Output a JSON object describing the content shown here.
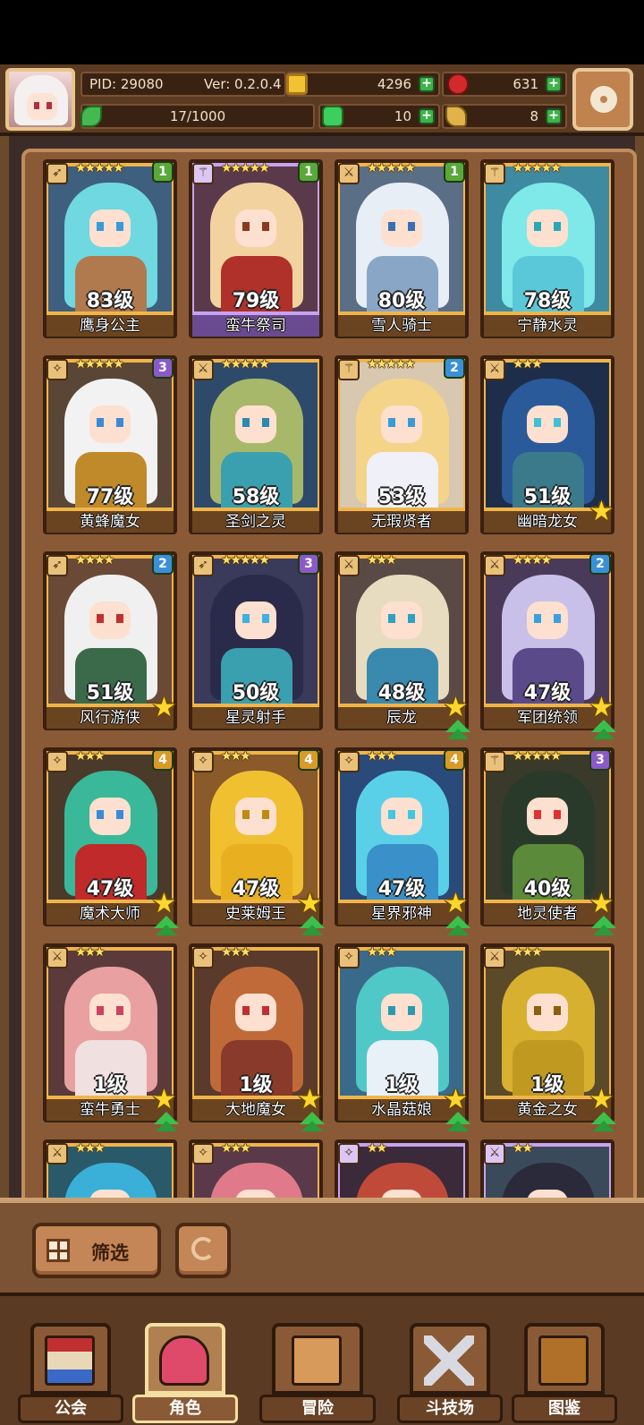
{
  "header": {
    "pid": "PID: 29080",
    "version": "Ver: 0.2.0.4",
    "gold": "4296",
    "gems": "631",
    "exp": "17/1000",
    "clover": "10",
    "keys": "8"
  },
  "heroes": [
    {
      "name": "鹰身公主",
      "level": "83级",
      "stars": "★★★★★",
      "rank": "1",
      "rank_color": "#5aa83a",
      "class_icon": "bow",
      "frame": "gold",
      "colors": {
        "bg": "#3e5f7e",
        "hair": "#6fd8e0",
        "body": "#b07a4e",
        "eye": "#3a9ad8"
      }
    },
    {
      "name": "蛮牛祭司",
      "level": "79级",
      "stars": "★★★★★",
      "rank": "1",
      "rank_color": "#5aa83a",
      "class_icon": "staff",
      "frame": "purple",
      "colors": {
        "bg": "#5a3a4a",
        "hair": "#f2d3a0",
        "body": "#b0302a",
        "eye": "#8a3a20"
      }
    },
    {
      "name": "雪人骑士",
      "level": "80级",
      "stars": "★★★★★",
      "rank": "1",
      "rank_color": "#5aa83a",
      "class_icon": "sword",
      "frame": "gold",
      "colors": {
        "bg": "#5a6e86",
        "hair": "#e8eef6",
        "body": "#8aa6c6",
        "eye": "#3a70b0"
      }
    },
    {
      "name": "宁静水灵",
      "level": "78级",
      "stars": "★★★★★",
      "rank": "",
      "rank_color": "",
      "class_icon": "staff",
      "frame": "gold",
      "colors": {
        "bg": "#3e8aa0",
        "hair": "#7fe8e8",
        "body": "#5ac8d8",
        "eye": "#2aa8b8"
      }
    },
    {
      "name": "黄蜂魔女",
      "level": "77级",
      "stars": "★★★★★",
      "rank": "3",
      "rank_color": "#8a5ac8",
      "class_icon": "wand",
      "frame": "gold",
      "colors": {
        "bg": "#5a4636",
        "hair": "#f2f2f2",
        "body": "#c08a2a",
        "eye": "#3a8ad8"
      }
    },
    {
      "name": "圣剑之灵",
      "level": "58级",
      "stars": "★★★★★",
      "rank": "",
      "rank_color": "",
      "class_icon": "sword",
      "frame": "gold",
      "colors": {
        "bg": "#2e4a6a",
        "hair": "#a8b86a",
        "body": "#3aa0b0",
        "eye": "#2a8ab0"
      }
    },
    {
      "name": "无瑕贤者",
      "level": "53级",
      "stars": "★★★★★",
      "rank": "2",
      "rank_color": "#3a90d8",
      "class_icon": "staff",
      "frame": "gold",
      "colors": {
        "bg": "#d8c8b0",
        "hair": "#f4d488",
        "body": "#f0f0f8",
        "eye": "#3a9ad8"
      }
    },
    {
      "name": "幽暗龙女",
      "level": "51级",
      "stars": "★★★",
      "rank": "",
      "rank_color": "",
      "class_icon": "sword",
      "frame": "gold",
      "star_badge": true,
      "colors": {
        "bg": "#1e2e4a",
        "hair": "#2a5a9a",
        "body": "#3a7a8a",
        "eye": "#40c0d8"
      }
    },
    {
      "name": "风行游侠",
      "level": "51级",
      "stars": "★★★★",
      "rank": "2",
      "rank_color": "#3a90d8",
      "class_icon": "bow",
      "frame": "gold",
      "star_badge": true,
      "colors": {
        "bg": "#6a4a36",
        "hair": "#f0f0f0",
        "body": "#3a6a4a",
        "eye": "#c03030"
      }
    },
    {
      "name": "星灵射手",
      "level": "50级",
      "stars": "★★★★★",
      "rank": "3",
      "rank_color": "#8a5ac8",
      "class_icon": "bow",
      "frame": "gold",
      "colors": {
        "bg": "#3a3a5a",
        "hair": "#2a2a4a",
        "body": "#3aa0b0",
        "eye": "#40b0e0"
      }
    },
    {
      "name": "辰龙",
      "level": "48级",
      "stars": "★★★",
      "rank": "",
      "rank_color": "",
      "class_icon": "sword",
      "frame": "gold",
      "star_badge": true,
      "up_badge": true,
      "colors": {
        "bg": "#5a4a46",
        "hair": "#e8dcc0",
        "body": "#3a8ab0",
        "eye": "#30a0c0"
      }
    },
    {
      "name": "军团统领",
      "level": "47级",
      "stars": "★★★★",
      "rank": "2",
      "rank_color": "#3a90d8",
      "class_icon": "sword",
      "frame": "gold",
      "star_badge": true,
      "up_badge": true,
      "colors": {
        "bg": "#4a3a5a",
        "hair": "#c8c0e8",
        "body": "#5a4a8a",
        "eye": "#3aa0e0"
      }
    },
    {
      "name": "魔术大师",
      "level": "47级",
      "stars": "★★★",
      "rank": "4",
      "rank_color": "#d89a2a",
      "class_icon": "wand",
      "frame": "gold",
      "star_badge": true,
      "up_badge": true,
      "colors": {
        "bg": "#4a3a2a",
        "hair": "#3ab89a",
        "body": "#c02a2a",
        "eye": "#3a8ad8"
      }
    },
    {
      "name": "史莱姆王",
      "level": "47级",
      "stars": "★★★",
      "rank": "4",
      "rank_color": "#d89a2a",
      "class_icon": "wand",
      "frame": "gold",
      "star_badge": true,
      "up_badge": true,
      "colors": {
        "bg": "#8a5a2a",
        "hair": "#f0c030",
        "body": "#e8b020",
        "eye": "#c08a10"
      }
    },
    {
      "name": "星界邪神",
      "level": "47级",
      "stars": "★★★",
      "rank": "4",
      "rank_color": "#d89a2a",
      "class_icon": "wand",
      "frame": "gold",
      "star_badge": true,
      "up_badge": true,
      "colors": {
        "bg": "#2a4a7a",
        "hair": "#5ad0e8",
        "body": "#3a90c8",
        "eye": "#40c8e0"
      }
    },
    {
      "name": "地灵使者",
      "level": "40级",
      "stars": "★★★★★",
      "rank": "3",
      "rank_color": "#8a5ac8",
      "class_icon": "staff",
      "frame": "gold",
      "star_badge": true,
      "up_badge": true,
      "colors": {
        "bg": "#3a3a2a",
        "hair": "#2a3a2a",
        "body": "#5a8a3a",
        "eye": "#e03030"
      }
    },
    {
      "name": "蛮牛勇士",
      "level": "1级",
      "stars": "★★★",
      "rank": "",
      "rank_color": "",
      "class_icon": "sword",
      "frame": "gold",
      "star_badge": true,
      "up_badge": true,
      "colors": {
        "bg": "#5a3a3a",
        "hair": "#e8a0a0",
        "body": "#f0e0e0",
        "eye": "#d04060"
      }
    },
    {
      "name": "大地魔女",
      "level": "1级",
      "stars": "★★★",
      "rank": "",
      "rank_color": "",
      "class_icon": "wand",
      "frame": "gold",
      "star_badge": true,
      "up_badge": true,
      "colors": {
        "bg": "#5a3a2a",
        "hair": "#c06a3a",
        "body": "#8a3a2a",
        "eye": "#c03030"
      }
    },
    {
      "name": "水晶菇娘",
      "level": "1级",
      "stars": "★★★",
      "rank": "",
      "rank_color": "",
      "class_icon": "wand",
      "frame": "gold",
      "star_badge": true,
      "up_badge": true,
      "colors": {
        "bg": "#3a6a8a",
        "hair": "#50c8c8",
        "body": "#e8f0f8",
        "eye": "#2a9ab0"
      }
    },
    {
      "name": "黄金之女",
      "level": "1级",
      "stars": "★★★",
      "rank": "",
      "rank_color": "",
      "class_icon": "sword",
      "frame": "gold",
      "star_badge": true,
      "up_badge": true,
      "colors": {
        "bg": "#5a4a2a",
        "hair": "#d8b030",
        "body": "#c09a20",
        "eye": "#8a6010"
      }
    },
    {
      "name": "",
      "level": "",
      "stars": "★★★",
      "rank": "",
      "rank_color": "",
      "class_icon": "sword",
      "frame": "gold",
      "colors": {
        "bg": "#2a5a6a",
        "hair": "#3ab0d8",
        "body": "#3a9ab0",
        "eye": "#2a9ab0"
      }
    },
    {
      "name": "",
      "level": "",
      "stars": "★★★",
      "rank": "",
      "rank_color": "",
      "class_icon": "wand",
      "frame": "gold",
      "colors": {
        "bg": "#5a3a4a",
        "hair": "#e07a8a",
        "body": "#8a3a4a",
        "eye": "#c03040"
      }
    },
    {
      "name": "",
      "level": "",
      "stars": "★★",
      "rank": "",
      "rank_color": "",
      "class_icon": "wand",
      "frame": "purple",
      "colors": {
        "bg": "#3a2a3a",
        "hair": "#c04a3a",
        "body": "#3a2a2a",
        "eye": "#c03030"
      }
    },
    {
      "name": "",
      "level": "",
      "stars": "★★",
      "rank": "",
      "rank_color": "",
      "class_icon": "sword",
      "frame": "purple",
      "colors": {
        "bg": "#3a4a5a",
        "hair": "#2a2a3a",
        "body": "#4a4a5a",
        "eye": "#8a8ab0"
      }
    }
  ],
  "filter": {
    "label": "筛选"
  },
  "nav": [
    {
      "label": "公会",
      "icon": "guild-icon",
      "active": false
    },
    {
      "label": "角色",
      "icon": "character-icon",
      "active": true
    },
    {
      "label": "冒险",
      "icon": "adventure-map-icon",
      "active": false
    },
    {
      "label": "斗技场",
      "icon": "arena-swords-icon",
      "active": false
    },
    {
      "label": "图鉴",
      "icon": "codex-book-icon",
      "active": false
    }
  ]
}
